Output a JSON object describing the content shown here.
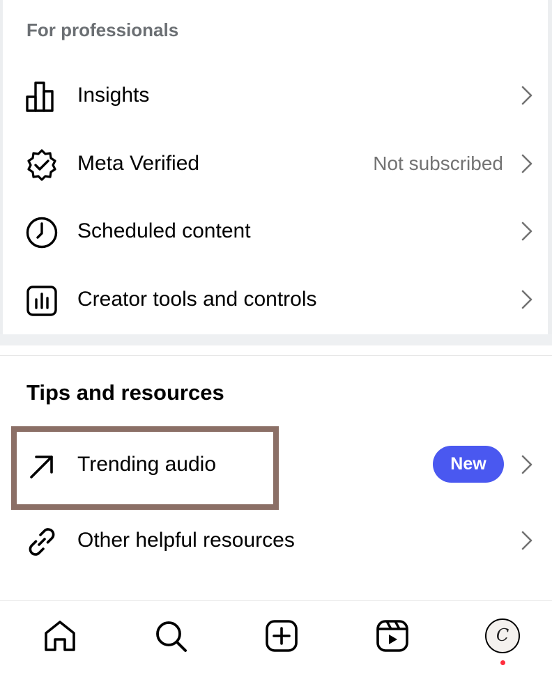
{
  "professionals": {
    "header": "For professionals",
    "items": [
      {
        "label": "Insights",
        "icon": "insights-bar-chart-icon"
      },
      {
        "label": "Meta Verified",
        "aux": "Not subscribed",
        "icon": "verified-badge-icon"
      },
      {
        "label": "Scheduled content",
        "icon": "clock-icon"
      },
      {
        "label": "Creator tools and controls",
        "icon": "creator-tools-icon"
      }
    ]
  },
  "tips": {
    "header": "Tips and resources",
    "items": [
      {
        "label": "Trending audio",
        "badge": "New",
        "icon": "trending-arrow-icon"
      },
      {
        "label": "Other helpful resources",
        "icon": "link-icon"
      }
    ]
  },
  "bottom_nav": {
    "tabs": [
      "home-icon",
      "search-icon",
      "create-icon",
      "reels-icon",
      "profile-avatar"
    ],
    "avatar_initial": "C",
    "notification_dot_color": "#ff2d3d"
  },
  "colors": {
    "badge": "#4a58f0",
    "highlight_border": "#8b6f66",
    "secondary_text": "#737373"
  }
}
